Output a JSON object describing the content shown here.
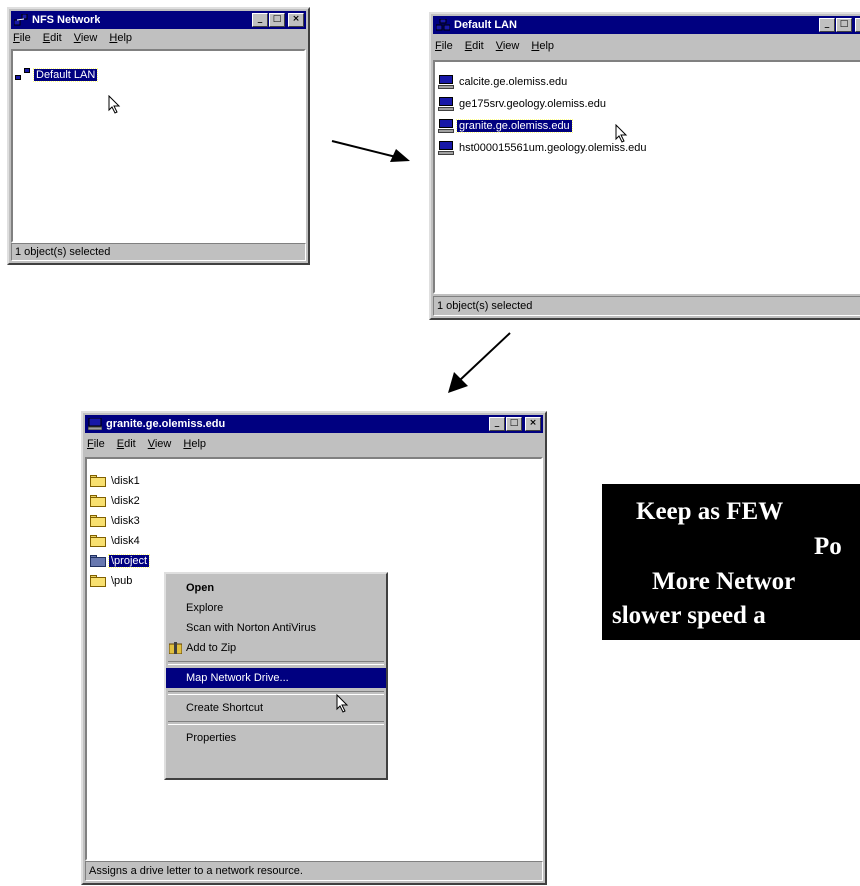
{
  "menus": [
    "File",
    "Edit",
    "View",
    "Help"
  ],
  "nfs_window": {
    "title": "NFS Network",
    "menu": [
      "File",
      "Edit",
      "View",
      "Help"
    ],
    "items": [
      {
        "label": "Default LAN",
        "selected": true
      }
    ],
    "status": "1 object(s) selected"
  },
  "lan_window": {
    "title": "Default LAN",
    "items": [
      {
        "label": "calcite.ge.olemiss.edu"
      },
      {
        "label": "ge175srv.geology.olemiss.edu"
      },
      {
        "label": "granite.ge.olemiss.edu",
        "selected": true
      },
      {
        "label": "hst000015561um.geology.olemiss.edu"
      }
    ],
    "status": "1 object(s) selected"
  },
  "granite_window": {
    "title": "granite.ge.olemiss.edu",
    "items": [
      {
        "label": "\\disk1"
      },
      {
        "label": "\\disk2"
      },
      {
        "label": "\\disk3"
      },
      {
        "label": "\\disk4"
      },
      {
        "label": "\\project",
        "selected": true
      },
      {
        "label": "\\pub"
      }
    ],
    "status": "Assigns a drive letter to a network resource."
  },
  "context_menu": {
    "items": [
      "Open",
      "Explore",
      "Scan with Norton AntiVirus",
      "Add to Zip",
      "Map Network Drive...",
      "Create Shortcut",
      "Properties"
    ],
    "default_item": "Open",
    "highlighted_item": "Map Network Drive..."
  },
  "callout": {
    "lines": [
      "Keep as FEW",
      "Po",
      "More Networ",
      "slower speed a"
    ]
  },
  "colors": {
    "titlebar": "#000080",
    "window_face": "#c0c0c0",
    "selection": "#000080",
    "callout_bg": "#000000",
    "callout_text": "#ffffff"
  }
}
